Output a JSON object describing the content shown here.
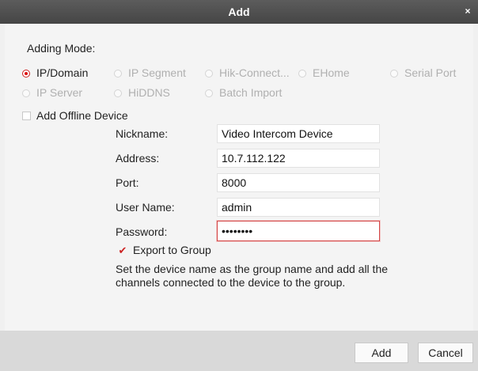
{
  "window": {
    "title": "Add",
    "close_glyph": "×"
  },
  "adding_mode": {
    "label": "Adding Mode:",
    "options": [
      {
        "label": "IP/Domain",
        "selected": true
      },
      {
        "label": "IP Segment",
        "selected": false
      },
      {
        "label": "Hik-Connect...",
        "selected": false
      },
      {
        "label": "EHome",
        "selected": false
      },
      {
        "label": "Serial Port",
        "selected": false
      },
      {
        "label": "IP Server",
        "selected": false
      },
      {
        "label": "HiDDNS",
        "selected": false
      },
      {
        "label": "Batch Import",
        "selected": false
      }
    ]
  },
  "offline": {
    "label": "Add Offline Device",
    "checked": false
  },
  "form": {
    "nickname": {
      "label": "Nickname:",
      "value": "Video Intercom Device"
    },
    "address": {
      "label": "Address:",
      "value": "10.7.112.122"
    },
    "port": {
      "label": "Port:",
      "value": "8000"
    },
    "username": {
      "label": "User Name:",
      "value": "admin"
    },
    "password": {
      "label": "Password:",
      "value": "••••••••"
    }
  },
  "export": {
    "label": "Export to Group",
    "checked": true,
    "check_glyph": "✔"
  },
  "hint": "Set the device name as the group name and add all the channels connected to the device to the group.",
  "buttons": {
    "add": "Add",
    "cancel": "Cancel"
  },
  "colors": {
    "accent": "#cc2222",
    "titlebar": "#4e4e4e",
    "footer": "#d9d9d9"
  }
}
